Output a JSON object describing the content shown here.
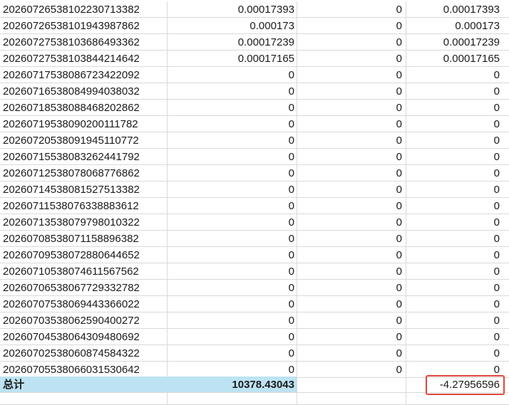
{
  "rows": [
    {
      "id": "20260726538102230713382",
      "b": "0.00017393",
      "c": "0",
      "d": "0.00017393"
    },
    {
      "id": "20260726538101943987862",
      "b": "0.000173",
      "c": "0",
      "d": "0.000173"
    },
    {
      "id": "20260727538103686493362",
      "b": "0.00017239",
      "c": "0",
      "d": "0.00017239"
    },
    {
      "id": "20260727538103844214642",
      "b": "0.00017165",
      "c": "0",
      "d": "0.00017165"
    },
    {
      "id": "20260717538086723422092",
      "b": "0",
      "c": "0",
      "d": "0"
    },
    {
      "id": "20260716538084994038032",
      "b": "0",
      "c": "0",
      "d": "0"
    },
    {
      "id": "20260718538088468202862",
      "b": "0",
      "c": "0",
      "d": "0"
    },
    {
      "id": "20260719538090200111782",
      "b": "0",
      "c": "0",
      "d": "0"
    },
    {
      "id": "20260720538091945110772",
      "b": "0",
      "c": "0",
      "d": "0"
    },
    {
      "id": "20260715538083262441792",
      "b": "0",
      "c": "0",
      "d": "0"
    },
    {
      "id": "20260712538078068776862",
      "b": "0",
      "c": "0",
      "d": "0"
    },
    {
      "id": "20260714538081527513382",
      "b": "0",
      "c": "0",
      "d": "0"
    },
    {
      "id": "20260711538076338883612",
      "b": "0",
      "c": "0",
      "d": "0"
    },
    {
      "id": "20260713538079798010322",
      "b": "0",
      "c": "0",
      "d": "0"
    },
    {
      "id": "20260708538071158896382",
      "b": "0",
      "c": "0",
      "d": "0"
    },
    {
      "id": "20260709538072880644652",
      "b": "0",
      "c": "0",
      "d": "0"
    },
    {
      "id": "20260710538074611567562",
      "b": "0",
      "c": "0",
      "d": "0"
    },
    {
      "id": "20260706538067729332782",
      "b": "0",
      "c": "0",
      "d": "0"
    },
    {
      "id": "20260707538069443366022",
      "b": "0",
      "c": "0",
      "d": "0"
    },
    {
      "id": "20260703538062590400272",
      "b": "0",
      "c": "0",
      "d": "0"
    },
    {
      "id": "20260704538064309480692",
      "b": "0",
      "c": "0",
      "d": "0"
    },
    {
      "id": "20260702538060874584322",
      "b": "0",
      "c": "0",
      "d": "0"
    },
    {
      "id": "20260705538066031530642",
      "b": "0",
      "c": "0",
      "d": "0"
    }
  ],
  "total": {
    "label": "总计",
    "b": "10378.43043",
    "c": "",
    "d": "-4.27956596"
  },
  "colors": {
    "total_fill": "#bde3f3",
    "highlight_border": "#e0463a",
    "grid": "#d9d9d9"
  }
}
